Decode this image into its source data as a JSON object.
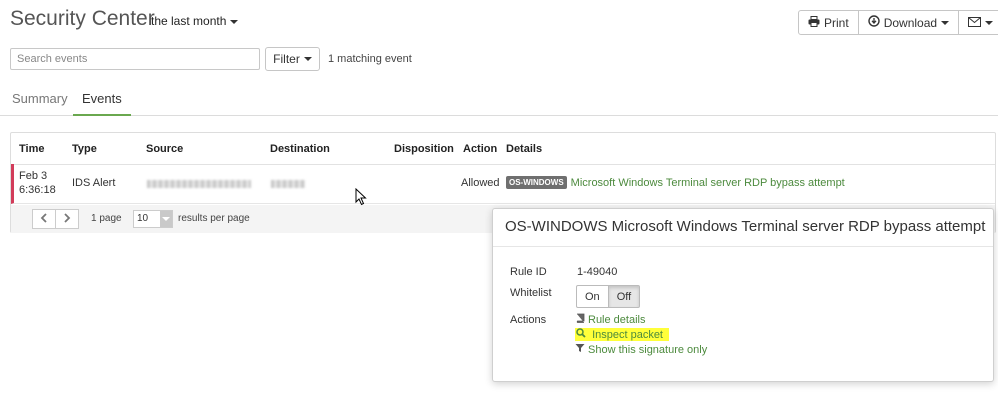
{
  "header": {
    "title": "Security Center",
    "period": "the last month"
  },
  "toolbar": {
    "print_label": "Print",
    "download_label": "Download"
  },
  "search": {
    "placeholder": "Search events",
    "value": ""
  },
  "filter": {
    "label": "Filter",
    "match_text": "1 matching event"
  },
  "tabs": [
    {
      "label": "Summary",
      "active": false
    },
    {
      "label": "Events",
      "active": true
    }
  ],
  "table": {
    "columns": [
      "Time",
      "Type",
      "Source",
      "Destination",
      "Disposition",
      "Action",
      "Details"
    ],
    "rows": [
      {
        "date": "Feb 3",
        "time": "6:36:18",
        "type": "IDS Alert",
        "disposition": "",
        "action": "Allowed",
        "badge": "OS-WINDOWS",
        "details": "Microsoft Windows Terminal server RDP bypass attempt"
      }
    ]
  },
  "pager": {
    "page_text": "1 page",
    "per_page": "10",
    "per_page_text": "results per page"
  },
  "popover": {
    "title": "OS-WINDOWS Microsoft Windows Terminal server RDP bypass attempt",
    "rule_id_label": "Rule ID",
    "rule_id": "1-49040",
    "whitelist_label": "Whitelist",
    "whitelist_on": "On",
    "whitelist_off": "Off",
    "whitelist_state": "Off",
    "actions_label": "Actions",
    "actions": [
      {
        "label": "Rule details",
        "icon": "book-icon"
      },
      {
        "label": "Inspect packet",
        "icon": "search-icon"
      },
      {
        "label": "Show this signature only",
        "icon": "filter-icon"
      }
    ]
  },
  "colors": {
    "accent": "#6aa84f",
    "link": "#4c8a3d",
    "row_marker": "#d23c5a",
    "highlight": "#ffff3a"
  }
}
